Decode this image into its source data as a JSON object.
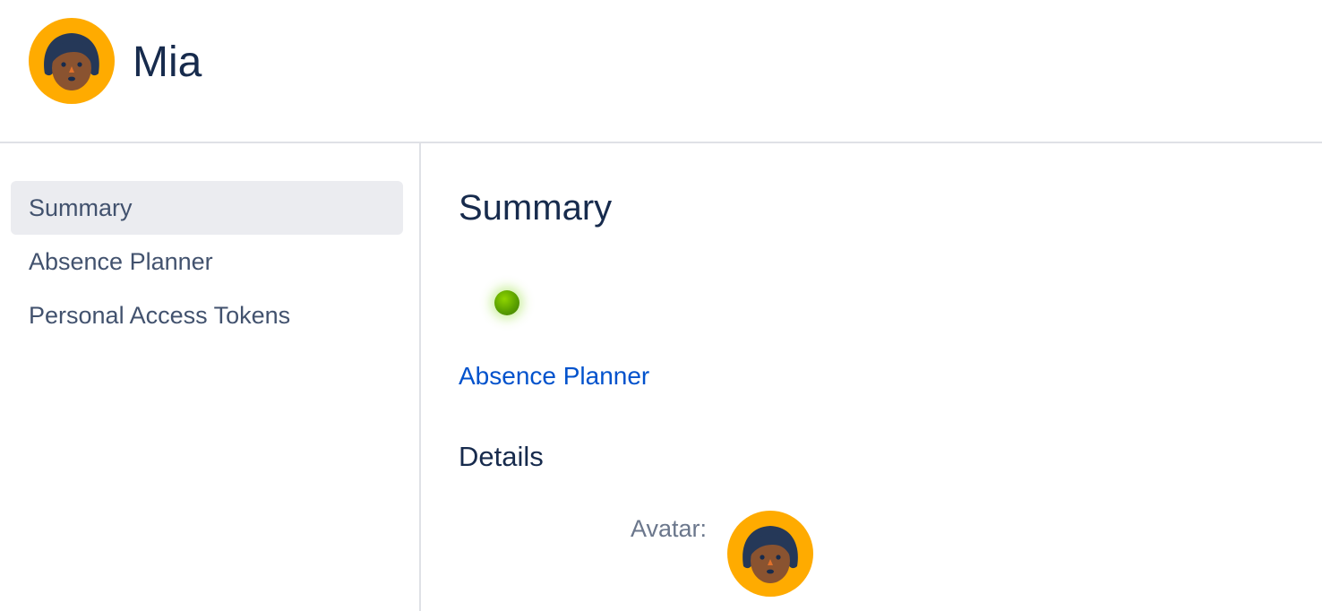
{
  "header": {
    "user_name": "Mia",
    "avatar_icon": "avatar-icon"
  },
  "sidebar": {
    "items": [
      {
        "label": "Summary",
        "active": true
      },
      {
        "label": "Absence Planner",
        "active": false
      },
      {
        "label": "Personal Access Tokens",
        "active": false
      }
    ]
  },
  "main": {
    "title": "Summary",
    "status": {
      "color": "#5aa000",
      "icon": "status-dot-icon"
    },
    "absence_link": "Absence Planner",
    "details": {
      "heading": "Details",
      "avatar_label": "Avatar:"
    }
  },
  "colors": {
    "avatar_bg": "#ffab00",
    "hair": "#253858",
    "skin": "#8a5330",
    "link": "#0052cc",
    "active_nav_bg": "#ebecf0"
  }
}
